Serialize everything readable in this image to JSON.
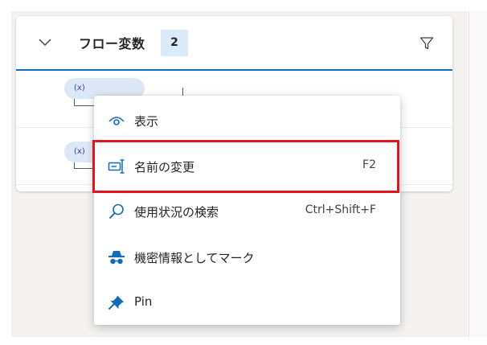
{
  "panel": {
    "title": "フロー変数",
    "count": "2",
    "icons": {
      "collapse": "chevron-down-icon",
      "filter": "filter-icon"
    }
  },
  "variables": [
    {
      "chip": "(x)"
    },
    {
      "chip": "(x)"
    }
  ],
  "context_menu": {
    "items": [
      {
        "label": "表示",
        "shortcut": "",
        "icon": "eye-icon"
      },
      {
        "label": "名前の変更",
        "shortcut": "F2",
        "icon": "rename-icon"
      },
      {
        "label": "使用状況の検索",
        "shortcut": "Ctrl+Shift+F",
        "icon": "search-icon"
      },
      {
        "label": "機密情報としてマーク",
        "shortcut": "",
        "icon": "incognito-icon"
      },
      {
        "label": "Pin",
        "shortcut": "",
        "icon": "pin-icon"
      }
    ]
  },
  "colors": {
    "accent": "#0f6cbd",
    "highlight": "#e3141b",
    "badge_bg": "#dce9f7"
  }
}
